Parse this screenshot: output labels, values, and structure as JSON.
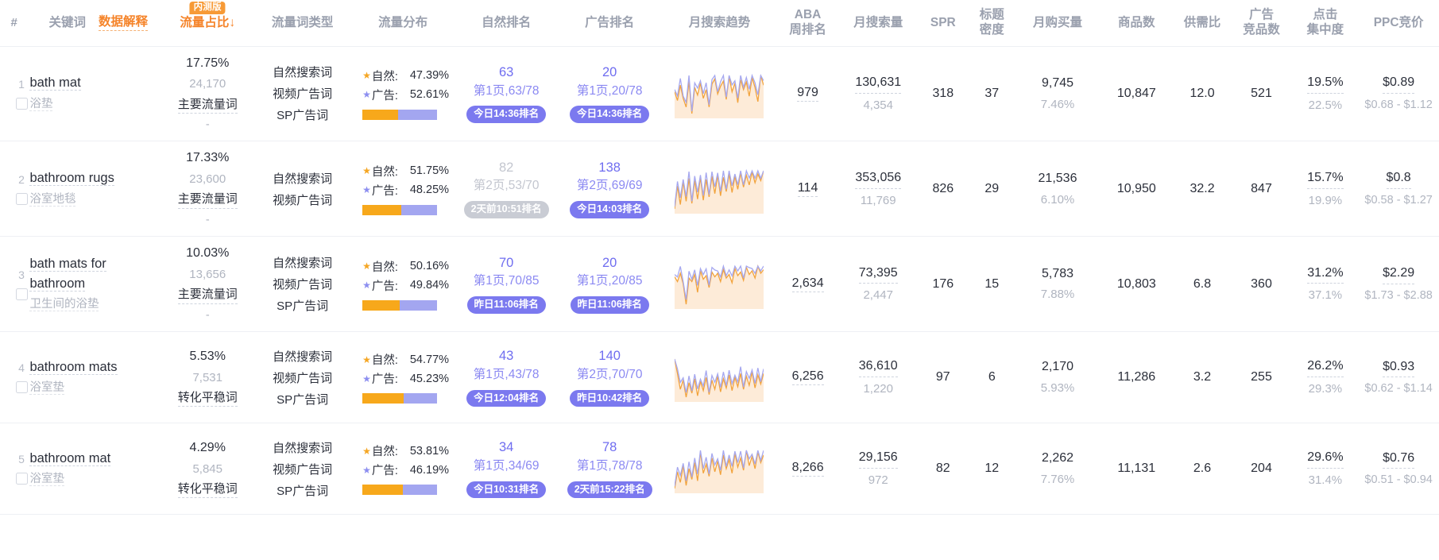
{
  "table": {
    "columns": [
      {
        "key": "index",
        "label": "#"
      },
      {
        "key": "keyword",
        "label": "关键词",
        "link_label": "数据解释"
      },
      {
        "key": "traffic_share",
        "label": "流量占比",
        "badge": "内测版",
        "sort": "↓"
      },
      {
        "key": "traffic_type",
        "label": "流量词类型"
      },
      {
        "key": "traffic_dist",
        "label": "流量分布"
      },
      {
        "key": "organic_rank",
        "label": "自然排名"
      },
      {
        "key": "ad_rank",
        "label": "广告排名"
      },
      {
        "key": "monthly_trend",
        "label": "月搜索趋势"
      },
      {
        "key": "aba",
        "label": "ABA",
        "label2": "周排名"
      },
      {
        "key": "monthly_search",
        "label": "月搜索量"
      },
      {
        "key": "spr",
        "label": "SPR"
      },
      {
        "key": "title_density",
        "label": "标题",
        "label2": "密度"
      },
      {
        "key": "monthly_purchase",
        "label": "月购买量"
      },
      {
        "key": "product_count",
        "label": "商品数"
      },
      {
        "key": "supply_demand",
        "label": "供需比"
      },
      {
        "key": "ad_competitors",
        "label": "广告",
        "label2": "竞品数"
      },
      {
        "key": "click_concentration",
        "label": "点击",
        "label2": "集中度"
      },
      {
        "key": "ppc_bid",
        "label": "PPC竞价"
      }
    ],
    "dist_labels": {
      "organic": "自然:",
      "ad": "广告:"
    },
    "rows": [
      {
        "index": "1",
        "keyword_en": "bath mat",
        "keyword_cn": "浴垫",
        "traffic_share_pct": "17.75%",
        "traffic_share_num": "24,170",
        "traffic_share_tag": "主要流量词",
        "traffic_share_extra": "-",
        "traffic_types": [
          "自然搜索词",
          "视频广告词",
          "SP广告词"
        ],
        "dist_organic": "47.39%",
        "dist_ad": "52.61%",
        "dist_organic_ratio": 47.39,
        "organic_rank": {
          "num": "63",
          "sub": "第1页,63/78",
          "pill": "今日14:36排名",
          "active": true
        },
        "ad_rank": {
          "num": "20",
          "sub": "第1页,20/78",
          "pill": "今日14:36排名",
          "active": true
        },
        "aba": "979",
        "monthly_search": "130,631",
        "monthly_search_sub": "4,354",
        "spr": "318",
        "title_density": "37",
        "monthly_purchase": "9,745",
        "monthly_purchase_sub": "7.46%",
        "product_count": "10,847",
        "supply_demand": "12.0",
        "ad_competitors": "521",
        "click_concentration": "19.5%",
        "click_concentration_sub": "22.5%",
        "ppc_bid": "$0.89",
        "ppc_range": "$0.68 - $1.12",
        "trend": [
          58,
          42,
          70,
          46,
          30,
          78,
          18,
          66,
          52,
          74,
          46,
          62,
          30,
          72,
          82,
          54,
          68,
          78,
          44,
          86,
          58,
          74,
          38,
          80,
          62,
          76,
          50,
          84,
          66,
          40,
          88,
          70
        ]
      },
      {
        "index": "2",
        "keyword_en": "bathroom rugs",
        "keyword_cn": "浴室地毯",
        "traffic_share_pct": "17.33%",
        "traffic_share_num": "23,600",
        "traffic_share_tag": "主要流量词",
        "traffic_share_extra": "-",
        "traffic_types": [
          "自然搜索词",
          "视频广告词"
        ],
        "dist_organic": "51.75%",
        "dist_ad": "48.25%",
        "dist_organic_ratio": 51.75,
        "organic_rank": {
          "num": "82",
          "sub": "第2页,53/70",
          "pill": "2天前10:51排名",
          "active": false
        },
        "ad_rank": {
          "num": "138",
          "sub": "第2页,69/69",
          "pill": "今日14:03排名",
          "active": true
        },
        "aba": "114",
        "monthly_search": "353,056",
        "monthly_search_sub": "11,769",
        "spr": "826",
        "title_density": "29",
        "monthly_purchase": "21,536",
        "monthly_purchase_sub": "6.10%",
        "product_count": "10,950",
        "supply_demand": "32.2",
        "ad_competitors": "847",
        "click_concentration": "15.7%",
        "click_concentration_sub": "19.9%",
        "ppc_bid": "$0.8",
        "ppc_range": "$0.58 - $1.27",
        "trend": [
          30,
          72,
          38,
          80,
          44,
          86,
          40,
          82,
          48,
          88,
          46,
          84,
          52,
          90,
          58,
          92,
          54,
          88,
          62,
          94,
          60,
          90,
          66,
          96,
          70,
          92,
          74,
          98,
          78,
          94,
          82,
          100
        ]
      },
      {
        "index": "3",
        "keyword_en": "bath mats for bathroom",
        "keyword_cn": "卫生间的浴垫",
        "traffic_share_pct": "10.03%",
        "traffic_share_num": "13,656",
        "traffic_share_tag": "主要流量词",
        "traffic_share_extra": "-",
        "traffic_types": [
          "自然搜索词",
          "视频广告词",
          "SP广告词"
        ],
        "dist_organic": "50.16%",
        "dist_ad": "49.84%",
        "dist_organic_ratio": 50.16,
        "organic_rank": {
          "num": "70",
          "sub": "第1页,70/85",
          "pill": "昨日11:06排名",
          "active": true
        },
        "ad_rank": {
          "num": "20",
          "sub": "第1页,20/85",
          "pill": "昨日11:06排名",
          "active": true
        },
        "aba": "2,634",
        "monthly_search": "73,395",
        "monthly_search_sub": "2,447",
        "spr": "176",
        "title_density": "15",
        "monthly_purchase": "5,783",
        "monthly_purchase_sub": "7.88%",
        "product_count": "10,803",
        "supply_demand": "6.8",
        "ad_competitors": "360",
        "click_concentration": "31.2%",
        "click_concentration_sub": "37.1%",
        "ppc_bid": "$2.29",
        "ppc_range": "$1.73 - $2.88",
        "trend": [
          66,
          58,
          72,
          54,
          20,
          64,
          58,
          70,
          40,
          76,
          62,
          68,
          48,
          74,
          66,
          72,
          58,
          78,
          64,
          70,
          56,
          80,
          68,
          74,
          60,
          82,
          70,
          76,
          64,
          84,
          72,
          78
        ]
      },
      {
        "index": "4",
        "keyword_en": "bathroom mats",
        "keyword_cn": "浴室垫",
        "traffic_share_pct": "5.53%",
        "traffic_share_num": "7,531",
        "traffic_share_tag": "转化平稳词",
        "traffic_share_extra": "",
        "traffic_types": [
          "自然搜索词",
          "视频广告词",
          "SP广告词"
        ],
        "dist_organic": "54.77%",
        "dist_ad": "45.23%",
        "dist_organic_ratio": 54.77,
        "organic_rank": {
          "num": "43",
          "sub": "第1页,43/78",
          "pill": "今日12:04排名",
          "active": true
        },
        "ad_rank": {
          "num": "140",
          "sub": "第2页,70/70",
          "pill": "昨日10:42排名",
          "active": true
        },
        "aba": "6,256",
        "monthly_search": "36,610",
        "monthly_search_sub": "1,220",
        "spr": "97",
        "title_density": "6",
        "monthly_purchase": "2,170",
        "monthly_purchase_sub": "5.93%",
        "product_count": "11,286",
        "supply_demand": "3.2",
        "ad_competitors": "255",
        "click_concentration": "26.2%",
        "click_concentration_sub": "29.3%",
        "ppc_bid": "$0.93",
        "ppc_range": "$0.62 - $1.14",
        "trend": [
          92,
          70,
          46,
          60,
          34,
          56,
          40,
          62,
          36,
          58,
          44,
          64,
          38,
          60,
          46,
          66,
          42,
          62,
          48,
          68,
          44,
          64,
          50,
          70,
          46,
          66,
          52,
          72,
          48,
          68,
          54,
          70
        ]
      },
      {
        "index": "5",
        "keyword_en": "bathroom mat",
        "keyword_cn": "浴室垫",
        "traffic_share_pct": "4.29%",
        "traffic_share_num": "5,845",
        "traffic_share_tag": "转化平稳词",
        "traffic_share_extra": "",
        "traffic_types": [
          "自然搜索词",
          "视频广告词",
          "SP广告词"
        ],
        "dist_organic": "53.81%",
        "dist_ad": "46.19%",
        "dist_organic_ratio": 53.81,
        "organic_rank": {
          "num": "34",
          "sub": "第1页,34/69",
          "pill": "今日10:31排名",
          "active": true
        },
        "ad_rank": {
          "num": "78",
          "sub": "第1页,78/78",
          "pill": "2天前15:22排名",
          "active": true
        },
        "aba": "8,266",
        "monthly_search": "29,156",
        "monthly_search_sub": "972",
        "spr": "82",
        "title_density": "12",
        "monthly_purchase": "2,262",
        "monthly_purchase_sub": "7.76%",
        "product_count": "11,131",
        "supply_demand": "2.6",
        "ad_competitors": "204",
        "click_concentration": "29.6%",
        "click_concentration_sub": "31.4%",
        "ppc_bid": "$0.76",
        "ppc_range": "$0.51 - $0.94",
        "trend": [
          40,
          62,
          48,
          70,
          44,
          66,
          52,
          74,
          50,
          88,
          60,
          72,
          56,
          80,
          62,
          76,
          58,
          84,
          66,
          78,
          60,
          86,
          68,
          80,
          64,
          90,
          70,
          82,
          66,
          88,
          74,
          84
        ]
      }
    ]
  },
  "colors": {
    "accent_orange": "#f5842a",
    "accent_purple": "#6f6df0",
    "bar_orange": "#f7a81b",
    "bar_purple": "#a3a6f0",
    "muted": "#b0b5c0"
  }
}
